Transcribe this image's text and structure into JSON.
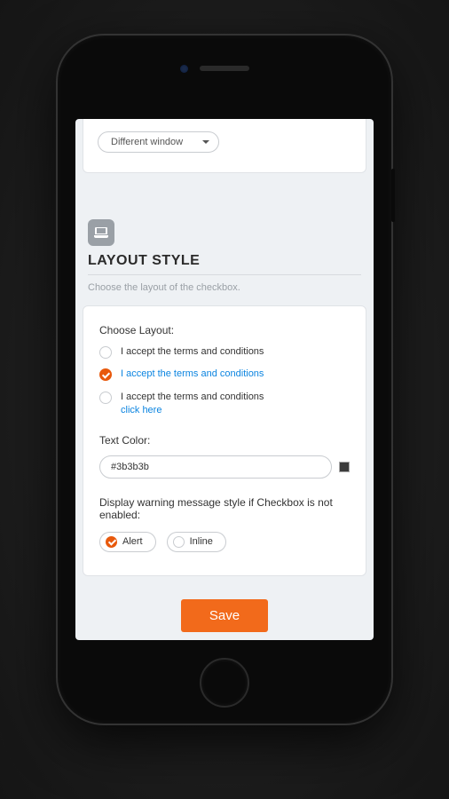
{
  "top": {
    "dropdown_value": "Different window"
  },
  "section": {
    "title": "LAYOUT STYLE",
    "subtitle": "Choose the layout of the checkbox."
  },
  "layout": {
    "choose_label": "Choose Layout:",
    "options": [
      {
        "text": "I accept the terms and conditions",
        "selected": false
      },
      {
        "text": "I accept the terms and conditions",
        "selected": true
      },
      {
        "text": "I accept the terms and conditions",
        "link": "click here",
        "selected": false
      }
    ],
    "text_color_label": "Text Color:",
    "text_color_value": "#3b3b3b",
    "warning_label": "Display warning message style if Checkbox is not enabled:",
    "warning_options": [
      {
        "label": "Alert",
        "selected": true
      },
      {
        "label": "Inline",
        "selected": false
      }
    ]
  },
  "actions": {
    "save": "Save"
  },
  "colors": {
    "accent": "#f26a1b",
    "link": "#0b84e0"
  }
}
